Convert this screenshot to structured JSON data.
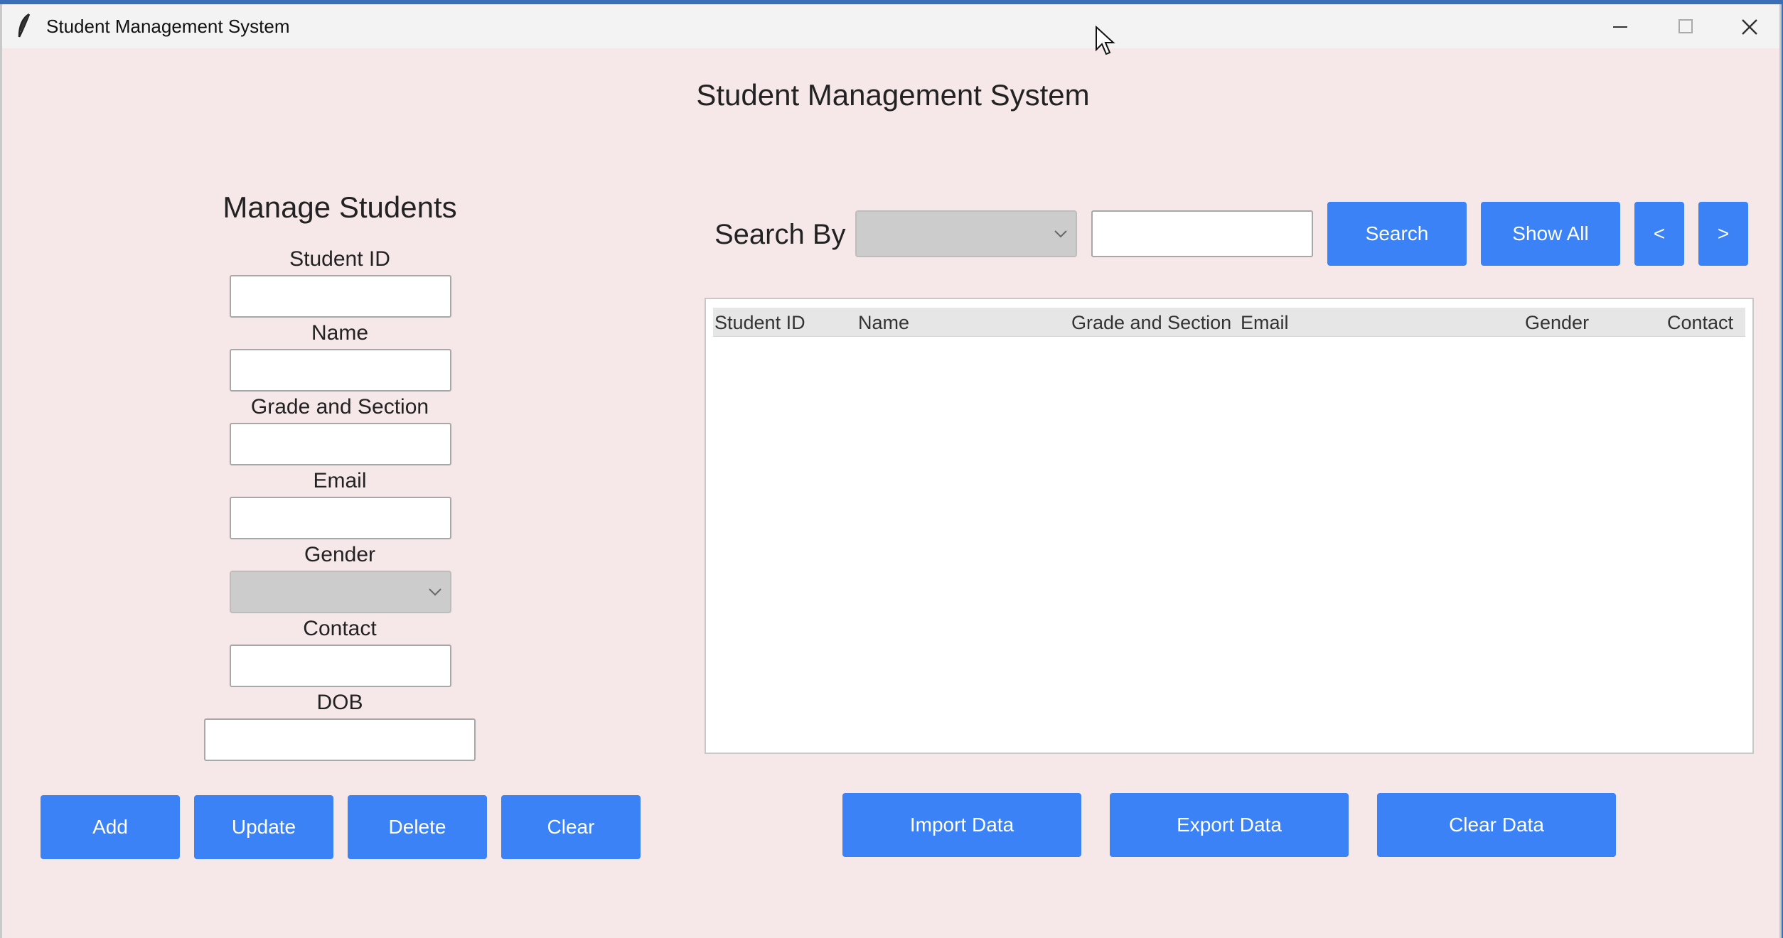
{
  "window": {
    "title": "Student Management System"
  },
  "app_title": "Student Management System",
  "form": {
    "heading": "Manage Students",
    "student_id_label": "Student ID",
    "student_id_value": "",
    "name_label": "Name",
    "name_value": "",
    "grade_label": "Grade and Section",
    "grade_value": "",
    "email_label": "Email",
    "email_value": "",
    "gender_label": "Gender",
    "gender_value": "",
    "contact_label": "Contact",
    "contact_value": "",
    "dob_label": "DOB",
    "dob_value": ""
  },
  "actions": {
    "add": "Add",
    "update": "Update",
    "delete": "Delete",
    "clear": "Clear"
  },
  "search": {
    "label": "Search By",
    "field_value": "",
    "query_value": "",
    "search_button": "Search",
    "show_all_button": "Show All",
    "prev_button": "<",
    "next_button": ">"
  },
  "table": {
    "columns": [
      "Student ID",
      "Name",
      "Grade and Section",
      "Email",
      "Gender",
      "Contact"
    ],
    "rows": []
  },
  "data_actions": {
    "import": "Import Data",
    "export": "Export Data",
    "clear": "Clear Data"
  },
  "colors": {
    "accent": "#3b82f6",
    "background": "#f6e8e9",
    "titlebar": "#f3f3f3"
  }
}
